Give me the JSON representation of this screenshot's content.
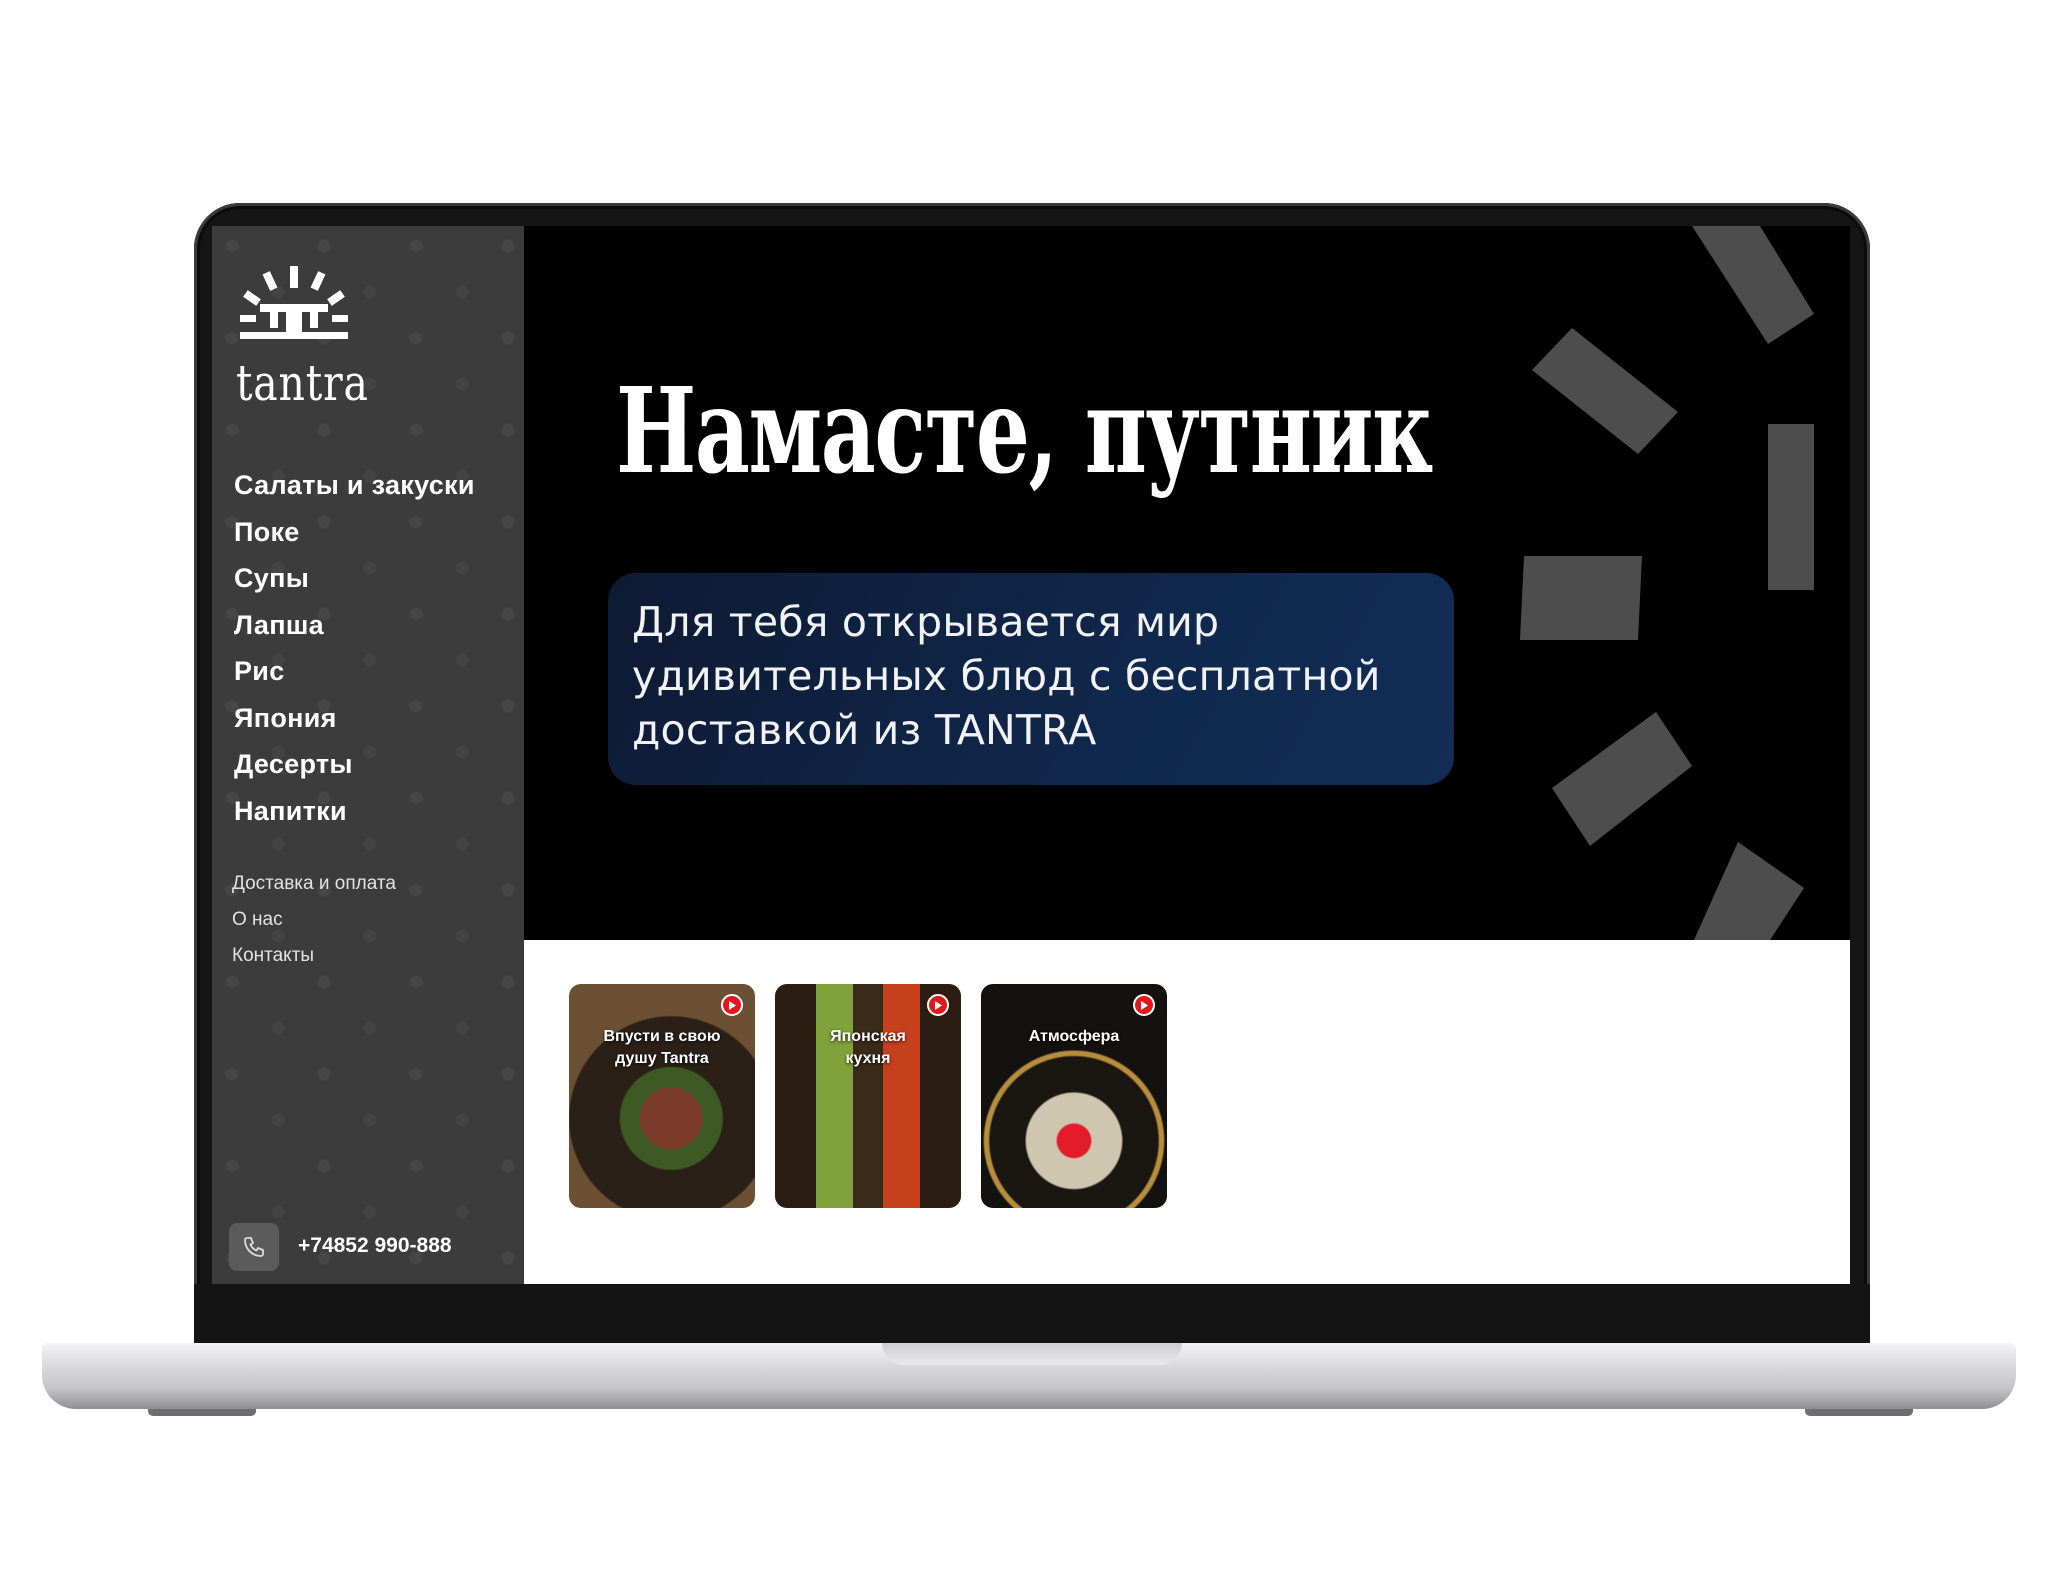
{
  "brand": {
    "name": "tantra"
  },
  "menu": {
    "categories": [
      "Салаты и закуски",
      "Поке",
      "Супы",
      "Лапша",
      "Рис",
      "Япония",
      "Десерты",
      "Напитки"
    ],
    "info_links": [
      "Доставка и оплата",
      "О нас",
      "Контакты"
    ]
  },
  "contact": {
    "phone": "+74852 990-888",
    "phone_icon": "phone-icon"
  },
  "hero": {
    "title": "Намасте, путник",
    "subtitle_lines": [
      "Для тебя открывается мир",
      "удивительных блюд с бесплатной",
      "доставкой из TANTRA"
    ]
  },
  "stories": [
    {
      "label_lines": [
        "Впусти в свою",
        "душу Tantra"
      ],
      "icon": "play-icon"
    },
    {
      "label_lines": [
        "Японская",
        "кухня"
      ],
      "icon": "play-icon"
    },
    {
      "label_lines": [
        "Атмосфера"
      ],
      "icon": "play-icon"
    }
  ],
  "colors": {
    "sidebar": "#3c3c3c",
    "hero_background": "#000000",
    "hero_card": "#10284c",
    "rays": "#4d4d4d",
    "story_badge": "#e3161b"
  }
}
